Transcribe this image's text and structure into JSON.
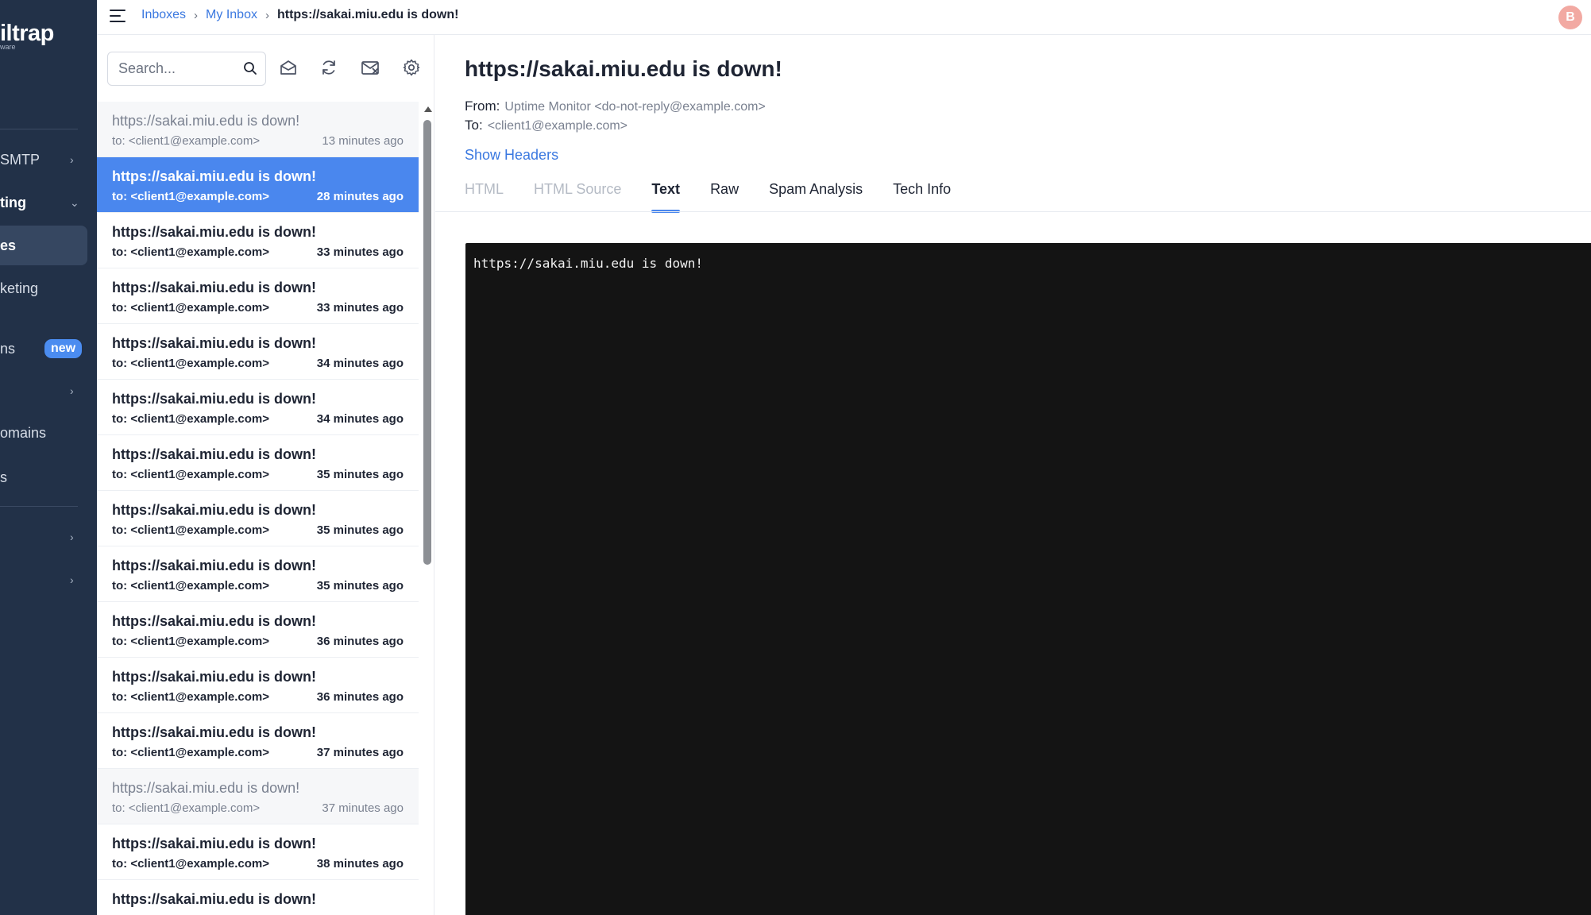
{
  "sidebar": {
    "logo": "iltrap",
    "logo_sub": "ware",
    "items": [
      {
        "label": "SMTP",
        "chev": "›"
      },
      {
        "label": "ting",
        "chev": "⌄"
      },
      {
        "label": "es"
      },
      {
        "label": "keting"
      },
      {
        "label": "ns",
        "badge": "new"
      },
      {
        "label": "",
        "chev": "›"
      },
      {
        "label": "omains"
      },
      {
        "label": "s"
      },
      {
        "label": "",
        "chev": "›"
      },
      {
        "label": "",
        "chev": "›"
      }
    ]
  },
  "topbar": {
    "breadcrumb": [
      "Inboxes",
      "My Inbox",
      "https://sakai.miu.edu is down!"
    ],
    "separator": "›",
    "avatar_initial": "B"
  },
  "list": {
    "search_placeholder": "Search...",
    "messages": [
      {
        "subject": "https://sakai.miu.edu is down!",
        "to": "to: <client1@example.com>",
        "ago": "13 minutes ago",
        "state": "read"
      },
      {
        "subject": "https://sakai.miu.edu is down!",
        "to": "to: <client1@example.com>",
        "ago": "28 minutes ago",
        "state": "selected"
      },
      {
        "subject": "https://sakai.miu.edu is down!",
        "to": "to: <client1@example.com>",
        "ago": "33 minutes ago",
        "state": "unread"
      },
      {
        "subject": "https://sakai.miu.edu is down!",
        "to": "to: <client1@example.com>",
        "ago": "33 minutes ago",
        "state": "unread"
      },
      {
        "subject": "https://sakai.miu.edu is down!",
        "to": "to: <client1@example.com>",
        "ago": "34 minutes ago",
        "state": "unread"
      },
      {
        "subject": "https://sakai.miu.edu is down!",
        "to": "to: <client1@example.com>",
        "ago": "34 minutes ago",
        "state": "unread"
      },
      {
        "subject": "https://sakai.miu.edu is down!",
        "to": "to: <client1@example.com>",
        "ago": "35 minutes ago",
        "state": "unread"
      },
      {
        "subject": "https://sakai.miu.edu is down!",
        "to": "to: <client1@example.com>",
        "ago": "35 minutes ago",
        "state": "unread"
      },
      {
        "subject": "https://sakai.miu.edu is down!",
        "to": "to: <client1@example.com>",
        "ago": "35 minutes ago",
        "state": "unread"
      },
      {
        "subject": "https://sakai.miu.edu is down!",
        "to": "to: <client1@example.com>",
        "ago": "36 minutes ago",
        "state": "unread"
      },
      {
        "subject": "https://sakai.miu.edu is down!",
        "to": "to: <client1@example.com>",
        "ago": "36 minutes ago",
        "state": "unread"
      },
      {
        "subject": "https://sakai.miu.edu is down!",
        "to": "to: <client1@example.com>",
        "ago": "37 minutes ago",
        "state": "unread"
      },
      {
        "subject": "https://sakai.miu.edu is down!",
        "to": "to: <client1@example.com>",
        "ago": "37 minutes ago",
        "state": "read"
      },
      {
        "subject": "https://sakai.miu.edu is down!",
        "to": "to: <client1@example.com>",
        "ago": "38 minutes ago",
        "state": "unread"
      },
      {
        "subject": "https://sakai.miu.edu is down!",
        "to": "",
        "ago": "",
        "state": "unread"
      }
    ]
  },
  "detail": {
    "title": "https://sakai.miu.edu is down!",
    "from_label": "From:",
    "from_value": "Uptime Monitor <do-not-reply@example.com>",
    "to_label": "To:",
    "to_value": "<client1@example.com>",
    "show_headers": "Show Headers",
    "tabs": [
      {
        "label": "HTML",
        "state": "disabled"
      },
      {
        "label": "HTML Source",
        "state": "disabled"
      },
      {
        "label": "Text",
        "state": "active"
      },
      {
        "label": "Raw",
        "state": "normal"
      },
      {
        "label": "Spam Analysis",
        "state": "normal"
      },
      {
        "label": "Tech Info",
        "state": "normal"
      }
    ],
    "body_text": "https://sakai.miu.edu is down!"
  },
  "colors": {
    "sidebar_bg": "#223148",
    "accent": "#4a87ee",
    "link": "#3a78e0",
    "text_bg": "#141414"
  }
}
